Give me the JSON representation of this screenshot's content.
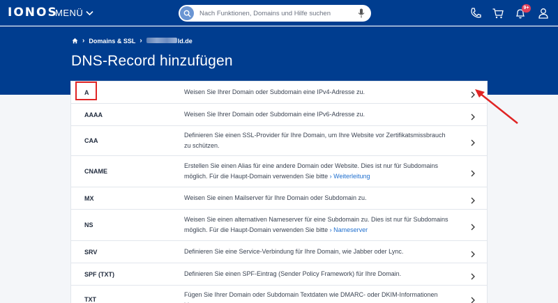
{
  "topbar": {
    "logo": "IONOS",
    "menu_label": "MENÜ",
    "search_placeholder": "Nach Funktionen, Domains und Hilfe suchen",
    "notifications_badge": "9+",
    "icons": [
      "phone-icon",
      "cart-icon",
      "bell-icon",
      "user-icon"
    ]
  },
  "breadcrumb": {
    "home_icon": "home-icon",
    "item1": "Domains & SSL",
    "domain_suffix": "ld.de"
  },
  "page": {
    "title": "DNS-Record hinzufügen"
  },
  "records": [
    {
      "type": "A",
      "description": "Weisen Sie Ihrer Domain oder Subdomain eine IPv4-Adresse zu."
    },
    {
      "type": "AAAA",
      "description": "Weisen Sie Ihrer Domain oder Subdomain eine IPv6-Adresse zu."
    },
    {
      "type": "CAA",
      "description": "Definieren Sie einen SSL-Provider für Ihre Domain, um Ihre Website vor Zertifikatsmissbrauch zu schützen."
    },
    {
      "type": "CNAME",
      "description": "Erstellen Sie einen Alias für eine andere Domain oder Website. Dies ist nur für Subdomains möglich. Für die Haupt-Domain verwenden Sie bitte",
      "link": "Weiterleitung"
    },
    {
      "type": "MX",
      "description": "Weisen Sie einen Mailserver für Ihre Domain oder Subdomain zu."
    },
    {
      "type": "NS",
      "description": "Weisen Sie einen alternativen Nameserver für eine Subdomain zu. Dies ist nur für Subdomains möglich. Für die Haupt-Domain verwenden Sie bitte",
      "link": "Nameserver"
    },
    {
      "type": "SRV",
      "description": "Definieren Sie eine Service-Verbindung für Ihre Domain, wie Jabber oder Lync."
    },
    {
      "type": "SPF (TXT)",
      "description": "Definieren Sie einen SPF-Eintrag (Sender Policy Framework) für Ihre Domain."
    },
    {
      "type": "TXT",
      "description": "Fügen Sie Ihrer Domain oder Subdomain Textdaten wie DMARC- oder DKIM-Informationen hinzu."
    }
  ],
  "colors": {
    "brand": "#003d8f",
    "accent": "#1f6fcf",
    "highlight": "#e02424",
    "badge": "#e0405b"
  }
}
